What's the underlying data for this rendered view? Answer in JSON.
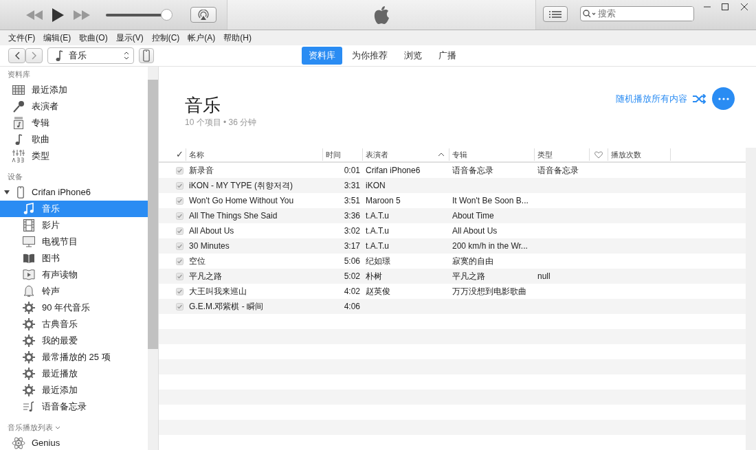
{
  "player": {
    "volume": {
      "level": 0.96
    }
  },
  "search": {
    "placeholder": "搜索"
  },
  "menu": [
    "文件(F)",
    "编辑(E)",
    "歌曲(O)",
    "显示(V)",
    "控制(C)",
    "帐户(A)",
    "帮助(H)"
  ],
  "source_select": {
    "value": "音乐"
  },
  "tabs": [
    {
      "label": "资料库",
      "selected": true
    },
    {
      "label": "为你推荐",
      "selected": false
    },
    {
      "label": "浏览",
      "selected": false
    },
    {
      "label": "广播",
      "selected": false
    }
  ],
  "sidebar": {
    "library": {
      "heading": "资料库",
      "items": [
        {
          "label": "最近添加",
          "selected": false
        },
        {
          "label": "表演者",
          "selected": false
        },
        {
          "label": "专辑",
          "selected": false
        },
        {
          "label": "歌曲",
          "selected": false
        },
        {
          "label": "类型",
          "selected": false
        }
      ]
    },
    "devices": {
      "heading": "设备",
      "device": {
        "name": "Crifan iPhone6",
        "expanded": true,
        "children": [
          {
            "label": "音乐",
            "selected": true
          },
          {
            "label": "影片",
            "selected": false
          },
          {
            "label": "电视节目",
            "selected": false
          },
          {
            "label": "图书",
            "selected": false
          },
          {
            "label": "有声读物",
            "selected": false
          },
          {
            "label": "铃声",
            "selected": false
          },
          {
            "label": "90 年代音乐",
            "selected": false
          },
          {
            "label": "古典音乐",
            "selected": false
          },
          {
            "label": "我的最爱",
            "selected": false
          },
          {
            "label": "最常播放的 25 项",
            "selected": false
          },
          {
            "label": "最近播放",
            "selected": false
          },
          {
            "label": "最近添加",
            "selected": false
          },
          {
            "label": "语音备忘录",
            "selected": false
          }
        ]
      }
    },
    "playlists": {
      "heading": "音乐播放列表",
      "items": [
        {
          "label": "Genius",
          "selected": false
        }
      ]
    }
  },
  "main": {
    "title": "音乐",
    "subtitle": "10 个项目 • 36 分钟",
    "shuffle_link": "随机播放所有内容"
  },
  "table": {
    "columns": [
      {
        "label": "✓",
        "sorted": false
      },
      {
        "label": "名称",
        "sorted": false
      },
      {
        "label": "时间",
        "sorted": false
      },
      {
        "label": "表演者",
        "sorted": true
      },
      {
        "label": "专辑",
        "sorted": false
      },
      {
        "label": "类型",
        "sorted": false
      },
      {
        "sorted": false
      },
      {
        "label": "播放次数",
        "sorted": false
      }
    ],
    "rows": [
      {
        "checked": true,
        "name": "新录音",
        "time": "0:01",
        "artist": "Crifan iPhone6",
        "album": "语音备忘录",
        "genre": "语音备忘录"
      },
      {
        "checked": true,
        "name": "iKON - MY TYPE (취향저격)",
        "time": "3:31",
        "artist": "iKON"
      },
      {
        "checked": true,
        "name": "Won't Go Home Without You",
        "time": "3:51",
        "artist": "Maroon 5",
        "album": "It Won't Be Soon B..."
      },
      {
        "checked": true,
        "name": "All The Things She Said",
        "time": "3:36",
        "artist": "t.A.T.u",
        "album": "About Time"
      },
      {
        "checked": true,
        "name": "All About Us",
        "time": "3:02",
        "artist": "t.A.T.u",
        "album": "All About Us"
      },
      {
        "checked": true,
        "name": "30 Minutes",
        "time": "3:17",
        "artist": "t.A.T.u",
        "album": "200 km/h in the Wr..."
      },
      {
        "checked": true,
        "name": "空位",
        "time": "5:06",
        "artist": "纪如璟",
        "album": "寂寞的自由"
      },
      {
        "checked": true,
        "name": "平凡之路",
        "time": "5:02",
        "artist": "朴树",
        "album": "平凡之路",
        "genre": "null"
      },
      {
        "checked": true,
        "name": "大王叫我来巡山",
        "time": "4:02",
        "artist": "赵英俊",
        "album": "万万没想到电影歌曲"
      },
      {
        "checked": true,
        "name": "G.E.M.邓紫棋 - 瞬间",
        "time": "4:06"
      }
    ]
  }
}
